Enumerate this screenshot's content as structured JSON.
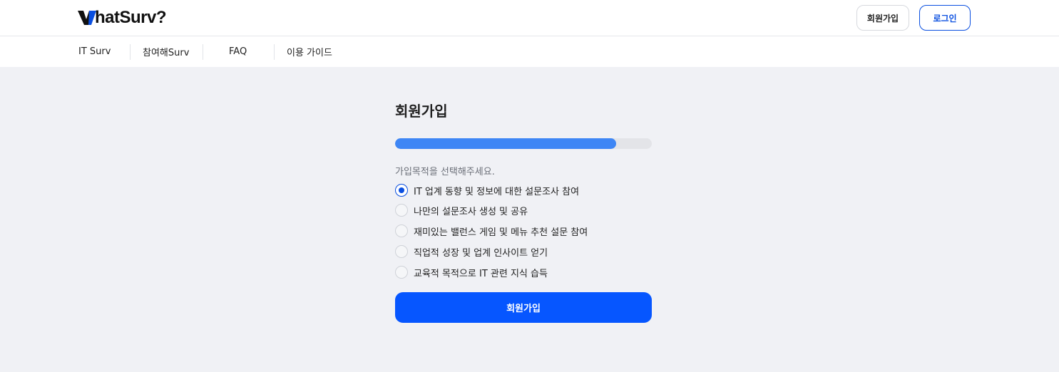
{
  "header": {
    "logo_text": "hatSurv?",
    "signup_label": "회원가입",
    "login_label": "로그인",
    "accent_color": "#0a4fe0"
  },
  "nav": {
    "items": [
      "IT Surv",
      "참여해Surv",
      "FAQ",
      "이용 가이드"
    ]
  },
  "signup": {
    "title": "회원가입",
    "progress_fraction": 0.86,
    "question": "가입목적을 선택해주세요.",
    "options": [
      {
        "label": "IT 업계 동향 및 정보에 대한 설문조사 참여",
        "selected": true
      },
      {
        "label": "나만의 설문조사 생성 및 공유",
        "selected": false
      },
      {
        "label": "재미있는 밸런스 게임 및 메뉴 추천 설문 참여",
        "selected": false
      },
      {
        "label": "직업적 성장 및 업계 인사이트 얻기",
        "selected": false
      },
      {
        "label": "교육적 목적으로 IT 관련 지식 습득",
        "selected": false
      }
    ],
    "submit_label": "회원가입",
    "submit_color": "#0656ff"
  }
}
